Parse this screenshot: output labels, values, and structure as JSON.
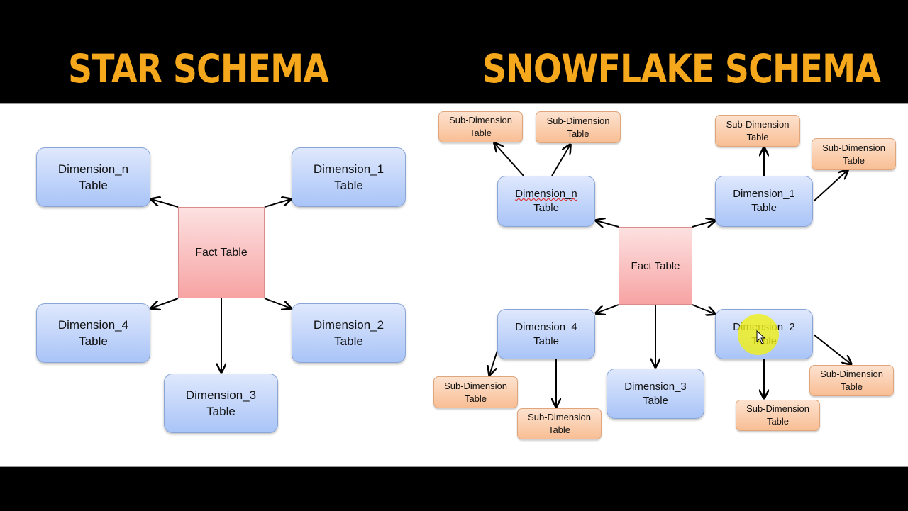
{
  "header": {
    "left_title": "STAR SCHEMA",
    "right_title": "SNOWFLAKE SCHEMA",
    "title_color": "#f6a81c"
  },
  "colors": {
    "dimension_fill": "#a9c4f7",
    "fact_fill": "#f7a3a3",
    "sub_dimension_fill": "#f8be94",
    "arrow": "#000000"
  },
  "star": {
    "fact": "Fact Table",
    "dimensions": {
      "dim_n": "Dimension_n\nTable",
      "dim_1": "Dimension_1\nTable",
      "dim_4": "Dimension_4\nTable",
      "dim_2": "Dimension_2\nTable",
      "dim_3": "Dimension_3\nTable"
    },
    "edges": [
      {
        "from": "fact",
        "to": "dim_n"
      },
      {
        "from": "fact",
        "to": "dim_1"
      },
      {
        "from": "fact",
        "to": "dim_4"
      },
      {
        "from": "fact",
        "to": "dim_2"
      },
      {
        "from": "fact",
        "to": "dim_3"
      }
    ]
  },
  "snowflake": {
    "fact": "Fact Table",
    "dimensions": {
      "dim_n": "Dimension_n\nTable",
      "dim_1": "Dimension_1\nTable",
      "dim_4": "Dimension_4\nTable",
      "dim_2": "Dimension_2\nTable",
      "dim_3": "Dimension_3\nTable"
    },
    "sub_dimensions": {
      "dim_n_a": "Sub-Dimension\nTable",
      "dim_n_b": "Sub-Dimension\nTable",
      "dim_1_a": "Sub-Dimension\nTable",
      "dim_1_b": "Sub-Dimension\nTable",
      "dim_4_a": "Sub-Dimension\nTable",
      "dim_4_b": "Sub-Dimension\nTable",
      "dim_2_a": "Sub-Dimension\nTable",
      "dim_2_b": "Sub-Dimension\nTable"
    },
    "edges": [
      {
        "from": "fact",
        "to": "dim_n"
      },
      {
        "from": "fact",
        "to": "dim_1"
      },
      {
        "from": "fact",
        "to": "dim_4"
      },
      {
        "from": "fact",
        "to": "dim_2"
      },
      {
        "from": "fact",
        "to": "dim_3"
      },
      {
        "from": "dim_n",
        "to": "dim_n_a"
      },
      {
        "from": "dim_n",
        "to": "dim_n_b"
      },
      {
        "from": "dim_1",
        "to": "dim_1_a"
      },
      {
        "from": "dim_1",
        "to": "dim_1_b"
      },
      {
        "from": "dim_4",
        "to": "dim_4_a"
      },
      {
        "from": "dim_4",
        "to": "dim_4_b"
      },
      {
        "from": "dim_2",
        "to": "dim_2_a"
      },
      {
        "from": "dim_2",
        "to": "dim_2_b"
      }
    ]
  }
}
